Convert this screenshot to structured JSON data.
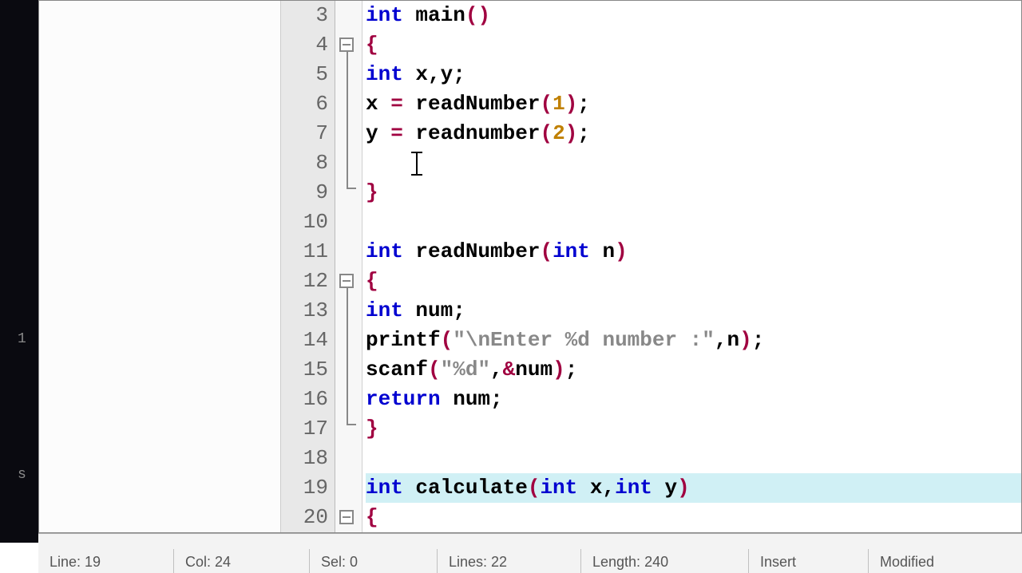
{
  "leftside": {
    "a": "1",
    "b": "s"
  },
  "lines": {
    "start": 3,
    "numbers": [
      "3",
      "4",
      "5",
      "6",
      "7",
      "8",
      "9",
      "10",
      "11",
      "12",
      "13",
      "14",
      "15",
      "16",
      "17",
      "18",
      "19",
      "20"
    ]
  },
  "code": {
    "l3": {
      "kw": "int",
      "fn": " main",
      "p1": "(",
      "p2": ")"
    },
    "l4": {
      "brace": "{"
    },
    "l5": {
      "kw": "int",
      "rest": " x,y;"
    },
    "l6": {
      "lhs": "x ",
      "eq": "=",
      "fn": " readNumber",
      "p1": "(",
      "arg": "1",
      "p2": ")",
      "semi": ";"
    },
    "l7": {
      "lhs": "y ",
      "eq": "=",
      "fn": " readnumber",
      "p1": "(",
      "arg": "2",
      "p2": ")",
      "semi": ";"
    },
    "l8": {
      "empty": " "
    },
    "l9": {
      "brace": "}"
    },
    "l11": {
      "kw": "int",
      "fn": " readNumber",
      "p1": "(",
      "argkw": "int",
      "argn": " n",
      "p2": ")"
    },
    "l12": {
      "brace": "{"
    },
    "l13": {
      "kw": "int",
      "rest": " num;"
    },
    "l14": {
      "fn": "printf",
      "p1": "(",
      "str": "\"\\nEnter %d number :\"",
      "comma": ",",
      "arg": "n",
      "p2": ")",
      "semi": ";"
    },
    "l15": {
      "fn": "scanf",
      "p1": "(",
      "str": "\"%d\"",
      "comma": ",",
      "amp": "&",
      "arg": "num",
      "p2": ")",
      "semi": ";"
    },
    "l16": {
      "kw": "return",
      "rest": " num;"
    },
    "l17": {
      "brace": "}"
    },
    "l19": {
      "kw": "int",
      "fn": " calculate",
      "p1": "(",
      "a1kw": "int",
      "a1n": " x",
      "comma": ",",
      "a2kw": "int",
      "a2n": " y",
      "p2": ")"
    },
    "l20": {
      "brace": "{"
    }
  },
  "status": {
    "line_label": "Line: ",
    "line_val": "19",
    "col_label": "Col: ",
    "col_val": "24",
    "sel_label": "Sel: ",
    "sel_val": "0",
    "lines_label": "Lines: ",
    "lines_val": "22",
    "length_label": "Length: ",
    "length_val": "240",
    "insert": "Insert",
    "modified": "Modified"
  }
}
